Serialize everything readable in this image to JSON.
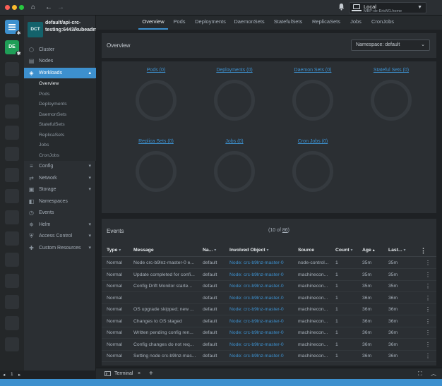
{
  "titlebar": {
    "traffic": [
      "#fd5f57",
      "#fdbc2e",
      "#28c840"
    ],
    "home_icon": "home-icon",
    "back_icon": "arrow-left-icon",
    "forward_icon": "arrow-right-icon",
    "bell_icon": "bell-icon",
    "context": {
      "name": "Local",
      "host": "MBP-de-EricM1.home"
    }
  },
  "hotbar": {
    "items": [
      {
        "type": "blue",
        "icon": "list-icon",
        "badge": "gear"
      },
      {
        "type": "green",
        "label": "DE",
        "badge": "gear"
      }
    ],
    "pager": {
      "prev": "◂",
      "page": "1",
      "next": "▸"
    }
  },
  "sidebar": {
    "cluster_badge": "DCT",
    "cluster_name": "default/api-crc-testing:6443/kubeadmin",
    "items": [
      {
        "label": "Cluster",
        "icon": "cluster-icon",
        "chev": ""
      },
      {
        "label": "Nodes",
        "icon": "nodes-icon",
        "chev": ""
      },
      {
        "label": "Workloads",
        "icon": "workloads-icon",
        "chev": "▴"
      },
      {
        "label": "Config",
        "icon": "config-icon",
        "chev": "▾"
      },
      {
        "label": "Network",
        "icon": "network-icon",
        "chev": "▾"
      },
      {
        "label": "Storage",
        "icon": "storage-icon",
        "chev": "▾"
      },
      {
        "label": "Namespaces",
        "icon": "namespaces-icon",
        "chev": ""
      },
      {
        "label": "Events",
        "icon": "events-icon",
        "chev": ""
      },
      {
        "label": "Helm",
        "icon": "helm-icon",
        "chev": "▾"
      },
      {
        "label": "Access Control",
        "icon": "access-control-icon",
        "chev": "▾"
      },
      {
        "label": "Custom Resources",
        "icon": "puzzle-icon",
        "chev": "▾"
      }
    ],
    "workload_sub": [
      "Overview",
      "Pods",
      "Deployments",
      "DaemonSets",
      "StatefulSets",
      "ReplicaSets",
      "Jobs",
      "CronJobs"
    ]
  },
  "tabs": [
    "Overview",
    "Pods",
    "Deployments",
    "DaemonSets",
    "StatefulSets",
    "ReplicaSets",
    "Jobs",
    "CronJobs"
  ],
  "overview": {
    "title": "Overview",
    "namespace_select": "Namespace: default",
    "charts": [
      "Pods (0)",
      "Deployments (0)",
      "Daemon Sets (0)",
      "Stateful Sets (0)",
      "Replica Sets (0)",
      "Jobs (0)",
      "Cron Jobs (0)"
    ]
  },
  "events": {
    "title": "Events",
    "count_prefix": "(10 of ",
    "count_total": "86",
    "count_suffix": ")",
    "columns": [
      "Type",
      "Message",
      "Na...",
      "Involved Object",
      "Source",
      "Count",
      "Age",
      "Last..."
    ],
    "sort_marks": [
      "▾",
      "",
      "▾",
      "▾",
      "",
      "▾",
      "▴",
      "▾"
    ],
    "rows": [
      {
        "type": "Normal",
        "message": "Node crc-b9lnz-master-0 e...",
        "namespace": "default",
        "object": "Node: crc-b9lnz-master-0",
        "source": "node-control...",
        "count": "1",
        "age": "35m",
        "last": "35m"
      },
      {
        "type": "Normal",
        "message": "Update completed for confi...",
        "namespace": "default",
        "object": "Node: crc-b9lnz-master-0",
        "source": "machinecon...",
        "count": "1",
        "age": "35m",
        "last": "35m"
      },
      {
        "type": "Normal",
        "message": "Config Drift Monitor starte...",
        "namespace": "default",
        "object": "Node: crc-b9lnz-master-0",
        "source": "machinecon...",
        "count": "1",
        "age": "35m",
        "last": "35m"
      },
      {
        "type": "Normal",
        "message": "",
        "namespace": "default",
        "object": "Node: crc-b9lnz-master-0",
        "source": "machinecon...",
        "count": "1",
        "age": "36m",
        "last": "36m"
      },
      {
        "type": "Normal",
        "message": "OS upgrade skipped; new ...",
        "namespace": "default",
        "object": "Node: crc-b9lnz-master-0",
        "source": "machinecon...",
        "count": "1",
        "age": "36m",
        "last": "36m"
      },
      {
        "type": "Normal",
        "message": "Changes to OS staged",
        "namespace": "default",
        "object": "Node: crc-b9lnz-master-0",
        "source": "machinecon...",
        "count": "1",
        "age": "36m",
        "last": "36m"
      },
      {
        "type": "Normal",
        "message": "Written pending config ren...",
        "namespace": "default",
        "object": "Node: crc-b9lnz-master-0",
        "source": "machinecon...",
        "count": "1",
        "age": "36m",
        "last": "36m"
      },
      {
        "type": "Normal",
        "message": "Config changes do not req...",
        "namespace": "default",
        "object": "Node: crc-b9lnz-master-0",
        "source": "machinecon...",
        "count": "1",
        "age": "36m",
        "last": "36m"
      },
      {
        "type": "Normal",
        "message": "Setting node crc-b9lnz-mas...",
        "namespace": "default",
        "object": "Node: crc-b9lnz-master-0",
        "source": "machinecon...",
        "count": "1",
        "age": "36m",
        "last": "36m"
      }
    ]
  },
  "terminal": {
    "label": "Terminal",
    "close": "×",
    "add": "+"
  }
}
